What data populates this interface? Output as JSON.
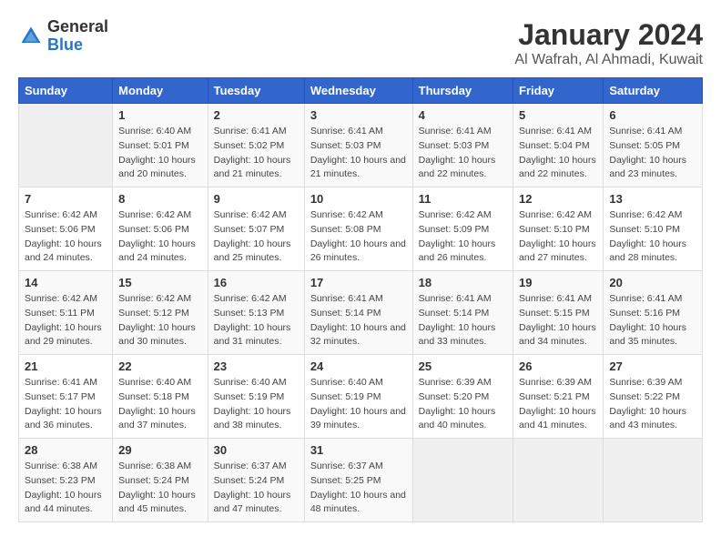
{
  "logo": {
    "line1": "General",
    "line2": "Blue"
  },
  "title": "January 2024",
  "subtitle": "Al Wafrah, Al Ahmadi, Kuwait",
  "weekdays": [
    "Sunday",
    "Monday",
    "Tuesday",
    "Wednesday",
    "Thursday",
    "Friday",
    "Saturday"
  ],
  "weeks": [
    [
      {
        "num": "",
        "sunrise": "",
        "sunset": "",
        "daylight": ""
      },
      {
        "num": "1",
        "sunrise": "Sunrise: 6:40 AM",
        "sunset": "Sunset: 5:01 PM",
        "daylight": "Daylight: 10 hours and 20 minutes."
      },
      {
        "num": "2",
        "sunrise": "Sunrise: 6:41 AM",
        "sunset": "Sunset: 5:02 PM",
        "daylight": "Daylight: 10 hours and 21 minutes."
      },
      {
        "num": "3",
        "sunrise": "Sunrise: 6:41 AM",
        "sunset": "Sunset: 5:03 PM",
        "daylight": "Daylight: 10 hours and 21 minutes."
      },
      {
        "num": "4",
        "sunrise": "Sunrise: 6:41 AM",
        "sunset": "Sunset: 5:03 PM",
        "daylight": "Daylight: 10 hours and 22 minutes."
      },
      {
        "num": "5",
        "sunrise": "Sunrise: 6:41 AM",
        "sunset": "Sunset: 5:04 PM",
        "daylight": "Daylight: 10 hours and 22 minutes."
      },
      {
        "num": "6",
        "sunrise": "Sunrise: 6:41 AM",
        "sunset": "Sunset: 5:05 PM",
        "daylight": "Daylight: 10 hours and 23 minutes."
      }
    ],
    [
      {
        "num": "7",
        "sunrise": "Sunrise: 6:42 AM",
        "sunset": "Sunset: 5:06 PM",
        "daylight": "Daylight: 10 hours and 24 minutes."
      },
      {
        "num": "8",
        "sunrise": "Sunrise: 6:42 AM",
        "sunset": "Sunset: 5:06 PM",
        "daylight": "Daylight: 10 hours and 24 minutes."
      },
      {
        "num": "9",
        "sunrise": "Sunrise: 6:42 AM",
        "sunset": "Sunset: 5:07 PM",
        "daylight": "Daylight: 10 hours and 25 minutes."
      },
      {
        "num": "10",
        "sunrise": "Sunrise: 6:42 AM",
        "sunset": "Sunset: 5:08 PM",
        "daylight": "Daylight: 10 hours and 26 minutes."
      },
      {
        "num": "11",
        "sunrise": "Sunrise: 6:42 AM",
        "sunset": "Sunset: 5:09 PM",
        "daylight": "Daylight: 10 hours and 26 minutes."
      },
      {
        "num": "12",
        "sunrise": "Sunrise: 6:42 AM",
        "sunset": "Sunset: 5:10 PM",
        "daylight": "Daylight: 10 hours and 27 minutes."
      },
      {
        "num": "13",
        "sunrise": "Sunrise: 6:42 AM",
        "sunset": "Sunset: 5:10 PM",
        "daylight": "Daylight: 10 hours and 28 minutes."
      }
    ],
    [
      {
        "num": "14",
        "sunrise": "Sunrise: 6:42 AM",
        "sunset": "Sunset: 5:11 PM",
        "daylight": "Daylight: 10 hours and 29 minutes."
      },
      {
        "num": "15",
        "sunrise": "Sunrise: 6:42 AM",
        "sunset": "Sunset: 5:12 PM",
        "daylight": "Daylight: 10 hours and 30 minutes."
      },
      {
        "num": "16",
        "sunrise": "Sunrise: 6:42 AM",
        "sunset": "Sunset: 5:13 PM",
        "daylight": "Daylight: 10 hours and 31 minutes."
      },
      {
        "num": "17",
        "sunrise": "Sunrise: 6:41 AM",
        "sunset": "Sunset: 5:14 PM",
        "daylight": "Daylight: 10 hours and 32 minutes."
      },
      {
        "num": "18",
        "sunrise": "Sunrise: 6:41 AM",
        "sunset": "Sunset: 5:14 PM",
        "daylight": "Daylight: 10 hours and 33 minutes."
      },
      {
        "num": "19",
        "sunrise": "Sunrise: 6:41 AM",
        "sunset": "Sunset: 5:15 PM",
        "daylight": "Daylight: 10 hours and 34 minutes."
      },
      {
        "num": "20",
        "sunrise": "Sunrise: 6:41 AM",
        "sunset": "Sunset: 5:16 PM",
        "daylight": "Daylight: 10 hours and 35 minutes."
      }
    ],
    [
      {
        "num": "21",
        "sunrise": "Sunrise: 6:41 AM",
        "sunset": "Sunset: 5:17 PM",
        "daylight": "Daylight: 10 hours and 36 minutes."
      },
      {
        "num": "22",
        "sunrise": "Sunrise: 6:40 AM",
        "sunset": "Sunset: 5:18 PM",
        "daylight": "Daylight: 10 hours and 37 minutes."
      },
      {
        "num": "23",
        "sunrise": "Sunrise: 6:40 AM",
        "sunset": "Sunset: 5:19 PM",
        "daylight": "Daylight: 10 hours and 38 minutes."
      },
      {
        "num": "24",
        "sunrise": "Sunrise: 6:40 AM",
        "sunset": "Sunset: 5:19 PM",
        "daylight": "Daylight: 10 hours and 39 minutes."
      },
      {
        "num": "25",
        "sunrise": "Sunrise: 6:39 AM",
        "sunset": "Sunset: 5:20 PM",
        "daylight": "Daylight: 10 hours and 40 minutes."
      },
      {
        "num": "26",
        "sunrise": "Sunrise: 6:39 AM",
        "sunset": "Sunset: 5:21 PM",
        "daylight": "Daylight: 10 hours and 41 minutes."
      },
      {
        "num": "27",
        "sunrise": "Sunrise: 6:39 AM",
        "sunset": "Sunset: 5:22 PM",
        "daylight": "Daylight: 10 hours and 43 minutes."
      }
    ],
    [
      {
        "num": "28",
        "sunrise": "Sunrise: 6:38 AM",
        "sunset": "Sunset: 5:23 PM",
        "daylight": "Daylight: 10 hours and 44 minutes."
      },
      {
        "num": "29",
        "sunrise": "Sunrise: 6:38 AM",
        "sunset": "Sunset: 5:24 PM",
        "daylight": "Daylight: 10 hours and 45 minutes."
      },
      {
        "num": "30",
        "sunrise": "Sunrise: 6:37 AM",
        "sunset": "Sunset: 5:24 PM",
        "daylight": "Daylight: 10 hours and 47 minutes."
      },
      {
        "num": "31",
        "sunrise": "Sunrise: 6:37 AM",
        "sunset": "Sunset: 5:25 PM",
        "daylight": "Daylight: 10 hours and 48 minutes."
      },
      {
        "num": "",
        "sunrise": "",
        "sunset": "",
        "daylight": ""
      },
      {
        "num": "",
        "sunrise": "",
        "sunset": "",
        "daylight": ""
      },
      {
        "num": "",
        "sunrise": "",
        "sunset": "",
        "daylight": ""
      }
    ]
  ]
}
